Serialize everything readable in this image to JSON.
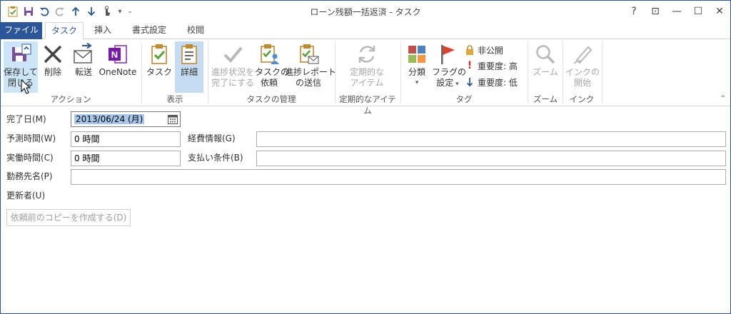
{
  "window": {
    "title": "ローン残額一括返済 - タスク",
    "controls": {
      "help": "?",
      "ribbon_options": "⊡",
      "minimize": "—",
      "maximize": "☐",
      "close": "✕"
    }
  },
  "tabs": [
    {
      "label": "ファイル"
    },
    {
      "label": "タスク"
    },
    {
      "label": "挿入"
    },
    {
      "label": "書式設定"
    },
    {
      "label": "校閲"
    }
  ],
  "ribbon": {
    "actions": {
      "save_close": [
        "保存して",
        "閉じる"
      ],
      "delete": "削除",
      "forward": "転送",
      "onenote": "OneNote",
      "group_label": "アクション"
    },
    "show": {
      "task": "タスク",
      "details": "詳細",
      "group_label": "表示"
    },
    "manage": {
      "mark_complete": [
        "進捗状況を",
        "完了にする"
      ],
      "assign": [
        "タスクの",
        "依頼"
      ],
      "send_status": [
        "進捗レポート",
        "の送信"
      ],
      "group_label": "タスクの管理"
    },
    "recurrence": {
      "recurrence": [
        "定期的な",
        "アイテム"
      ],
      "group_label": "定期的なアイテム"
    },
    "tags": {
      "categorize": "分類",
      "follow_up": [
        "フラグの",
        "設定"
      ],
      "private": "非公開",
      "high_importance": "重要度: 高",
      "low_importance": "重要度: 低",
      "group_label": "タグ"
    },
    "zoom": {
      "zoom": "ズーム",
      "group_label": "ズーム"
    },
    "ink": {
      "start_inking": [
        "インクの",
        "開始"
      ],
      "group_label": "インク"
    },
    "accent": "#2b579a"
  },
  "form": {
    "date_completed": {
      "label": "完了日(M)",
      "value": "2013/06/24 (月)"
    },
    "total_work": {
      "label": "予測時間(W)",
      "value": "0 時間"
    },
    "actual_work": {
      "label": "実働時間(C)",
      "value": "0 時間"
    },
    "company": {
      "label": "勤務先名(P)",
      "value": ""
    },
    "update_list": {
      "label": "更新者(U)"
    },
    "mileage": {
      "label": "経費情報(G)",
      "value": ""
    },
    "billing": {
      "label": "支払い条件(B)",
      "value": ""
    },
    "create_copy": "依頼前のコピーを作成する(D)"
  }
}
